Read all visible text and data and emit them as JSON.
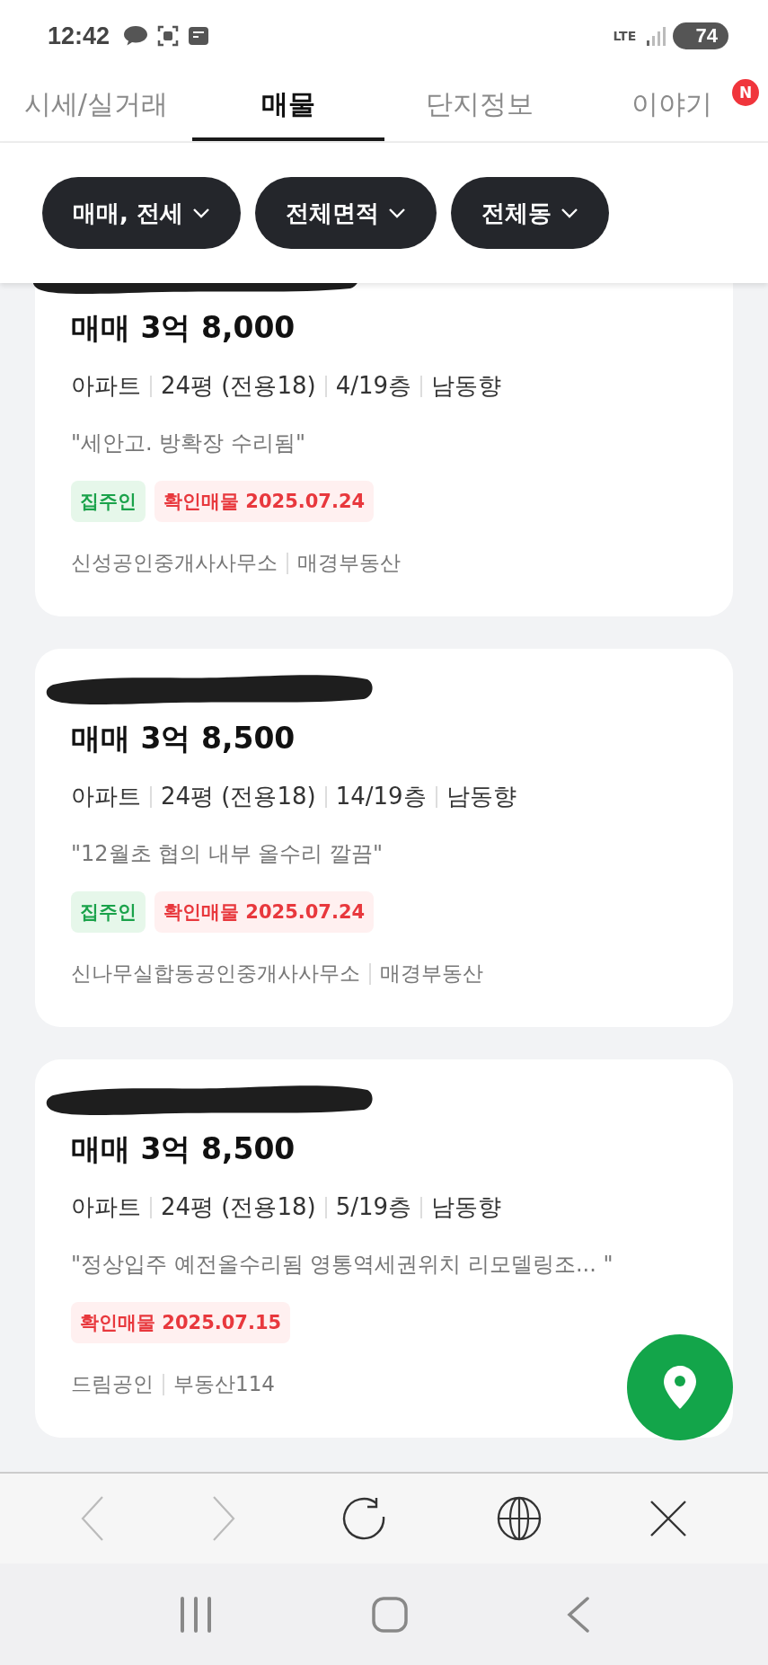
{
  "status_bar": {
    "time": "12:42",
    "network": "LTE",
    "battery": "74"
  },
  "tabs": [
    {
      "label": "시세/실거래",
      "selected": false
    },
    {
      "label": "매물",
      "selected": true
    },
    {
      "label": "단지정보",
      "selected": false
    },
    {
      "label": "이야기",
      "selected": false,
      "badge": "N"
    }
  ],
  "filters": [
    "매매, 전세",
    "전체면적",
    "전체동"
  ],
  "listings": [
    {
      "price": "매매 3억 8,000",
      "info": [
        "아파트",
        "24평 (전용18)",
        "4/19층",
        "남동향"
      ],
      "description": "\"세안고. 방확장 수리됨\"",
      "tags": [
        {
          "kind": "owner",
          "text": "집주인"
        },
        {
          "kind": "verified",
          "text": "확인매물 2025.07.24"
        }
      ],
      "agents": [
        "신성공인중개사사무소",
        "매경부동산"
      ]
    },
    {
      "price": "매매 3억 8,500",
      "info": [
        "아파트",
        "24평 (전용18)",
        "14/19층",
        "남동향"
      ],
      "description": "\"12월초 협의 내부 올수리 깔끔\"",
      "tags": [
        {
          "kind": "owner",
          "text": "집주인"
        },
        {
          "kind": "verified",
          "text": "확인매물 2025.07.24"
        }
      ],
      "agents": [
        "신나무실합동공인중개사사무소",
        "매경부동산"
      ]
    },
    {
      "price": "매매 3억 8,500",
      "info": [
        "아파트",
        "24평 (전용18)",
        "5/19층",
        "남동향"
      ],
      "description": "\"정상입주 예전올수리됨 영통역세권위치 리모델링조...  \"",
      "tags": [
        {
          "kind": "verified",
          "text": "확인매물 2025.07.15"
        }
      ],
      "agents": [
        "드림공인",
        "부동산114"
      ]
    }
  ]
}
